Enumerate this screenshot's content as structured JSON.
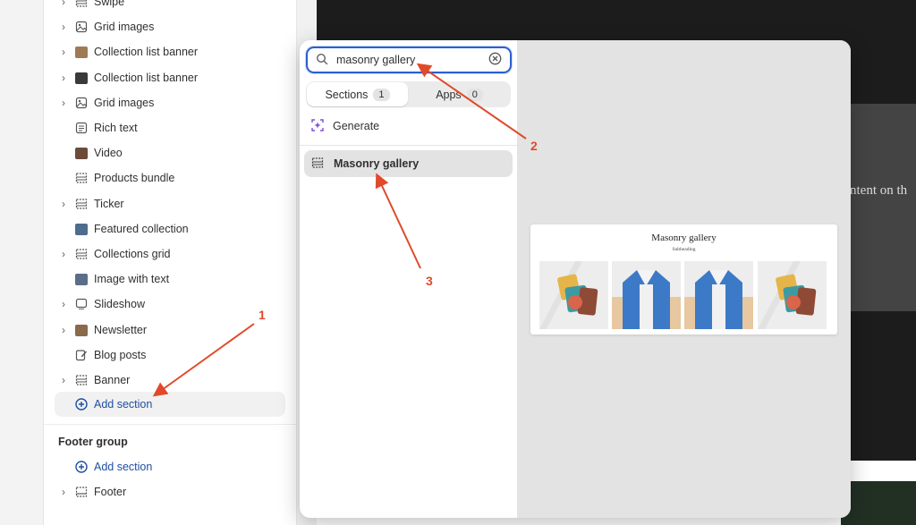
{
  "sidebar": {
    "items": [
      {
        "label": "Swipe",
        "icon": "section-icon",
        "chevron": true
      },
      {
        "label": "Grid images",
        "icon": "image-icon",
        "chevron": true
      },
      {
        "label": "Collection list banner",
        "icon": "thumbnail-icon",
        "chevron": true
      },
      {
        "label": "Collection list banner",
        "icon": "thumbnail-icon",
        "chevron": true
      },
      {
        "label": "Grid images",
        "icon": "image-icon",
        "chevron": true
      },
      {
        "label": "Rich text",
        "icon": "text-icon",
        "chevron": false
      },
      {
        "label": "Video",
        "icon": "thumbnail-icon",
        "chevron": false
      },
      {
        "label": "Products bundle",
        "icon": "section-icon",
        "chevron": false
      },
      {
        "label": "Ticker",
        "icon": "section-icon",
        "chevron": true
      },
      {
        "label": "Featured collection",
        "icon": "thumbnail-icon",
        "chevron": false
      },
      {
        "label": "Collections grid",
        "icon": "section-icon",
        "chevron": true
      },
      {
        "label": "Image with text",
        "icon": "thumbnail-icon",
        "chevron": false
      },
      {
        "label": "Slideshow",
        "icon": "slideshow-icon",
        "chevron": true
      },
      {
        "label": "Newsletter",
        "icon": "thumbnail-icon",
        "chevron": true
      },
      {
        "label": "Blog posts",
        "icon": "edit-icon",
        "chevron": false
      },
      {
        "label": "Banner",
        "icon": "section-icon",
        "chevron": true
      }
    ],
    "add_section": "Add section",
    "footer_group": "Footer group",
    "footer_add_section": "Add section",
    "footer_item": "Footer"
  },
  "popup": {
    "search_value": "masonry gallery",
    "tabs": [
      {
        "label": "Sections",
        "count": "1"
      },
      {
        "label": "Apps",
        "count": "0"
      }
    ],
    "generate_label": "Generate",
    "result_label": "Masonry gallery",
    "preview": {
      "title": "Masonry gallery",
      "subheading": "Subheading"
    }
  },
  "background_preview_text": "ntent on th",
  "annotations": [
    "1",
    "2",
    "3"
  ],
  "colors": {
    "accent": "#2c5fd1",
    "link": "#1f4fa3",
    "arrow": "#e04a2a",
    "generate_icon": "#7a4de0"
  }
}
